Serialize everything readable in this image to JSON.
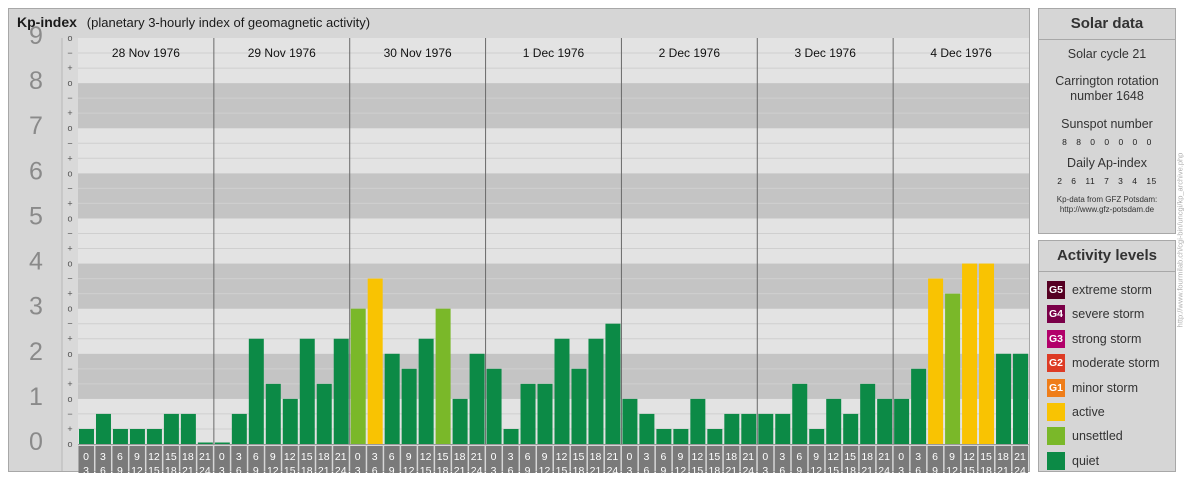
{
  "header": {
    "title": "Kp-index",
    "subtitle": "(planetary 3-hourly index of geomagnetic activity)"
  },
  "chart_data": {
    "type": "bar",
    "title": "Kp-index",
    "subtitle": "(planetary 3-hourly index of geomagnetic activity)",
    "ylim": [
      0,
      9
    ],
    "y_major_ticks": [
      "0",
      "1",
      "2",
      "3",
      "4",
      "5",
      "6",
      "7",
      "8",
      "9"
    ],
    "y_minor_tick_labels": [
      "+",
      "o",
      "−"
    ],
    "x_hour_start_labels": [
      "0",
      "3",
      "6",
      "9",
      "12",
      "15",
      "18",
      "21"
    ],
    "x_hour_end_labels": [
      "3",
      "6",
      "9",
      "12",
      "15",
      "18",
      "21",
      "24"
    ],
    "days": [
      {
        "date": "28 Nov 1976",
        "kp": [
          0.333,
          0.667,
          0.333,
          0.333,
          0.333,
          0.667,
          0.667,
          0.0
        ]
      },
      {
        "date": "29 Nov 1976",
        "kp": [
          0.0,
          0.667,
          2.333,
          1.333,
          1.0,
          2.333,
          1.333,
          2.333
        ]
      },
      {
        "date": "30 Nov 1976",
        "kp": [
          3.0,
          3.667,
          2.0,
          1.667,
          2.333,
          3.0,
          1.0,
          2.0
        ]
      },
      {
        "date": "1 Dec 1976",
        "kp": [
          1.667,
          0.333,
          1.333,
          1.333,
          2.333,
          1.667,
          2.333,
          2.667
        ]
      },
      {
        "date": "2 Dec 1976",
        "kp": [
          1.0,
          0.667,
          0.333,
          0.333,
          1.0,
          0.333,
          0.667,
          0.667
        ]
      },
      {
        "date": "3 Dec 1976",
        "kp": [
          0.667,
          0.667,
          1.333,
          0.333,
          1.0,
          0.667,
          1.333,
          1.0
        ]
      },
      {
        "date": "4 Dec 1976",
        "kp": [
          1.0,
          1.667,
          3.667,
          3.333,
          4.0,
          4.0,
          2.0,
          2.0
        ]
      }
    ],
    "color_scale": [
      {
        "level": "quiet",
        "max_kp": 2.99,
        "color": "#0c8a46"
      },
      {
        "level": "unsettled",
        "max_kp": 3.49,
        "color": "#7ab829"
      },
      {
        "level": "active",
        "max_kp": 4.99,
        "color": "#f9c302"
      }
    ],
    "colors": {
      "panel_bg": "#d6d6d6",
      "band_dark": "#c4c4c4",
      "band_light": "#e3e3e3",
      "minor_line": "#cfcfcf",
      "tick_gutter": "#d9d9d9",
      "axis_number": "#8a8a8a",
      "hour_cell": "#7a7a7a",
      "day_divider": "#6a6a6a"
    }
  },
  "solar_data": {
    "title": "Solar data",
    "solar_cycle": "Solar cycle 21",
    "carrington_line1": "Carrington rotation",
    "carrington_line2": "number 1648",
    "sunspot_label": "Sunspot number",
    "sunspot_values": "8 8 0 0 0 0 0",
    "ap_label": "Daily Ap-index",
    "ap_values": "2 6 11 7 3 4 15",
    "source_line1": "Kp-data from GFZ Potsdam:",
    "source_line2": "http://www.gfz-potsdam.de"
  },
  "activity_levels": {
    "title": "Activity levels",
    "items": [
      {
        "code": "G5",
        "label": "extreme storm",
        "color": "#550022"
      },
      {
        "code": "G4",
        "label": "severe storm",
        "color": "#7a0048"
      },
      {
        "code": "G3",
        "label": "strong storm",
        "color": "#b2006a"
      },
      {
        "code": "G2",
        "label": "moderate storm",
        "color": "#dd3b25"
      },
      {
        "code": "G1",
        "label": "minor storm",
        "color": "#ef7d18"
      },
      {
        "code": "",
        "label": "active",
        "color": "#f9c302"
      },
      {
        "code": "",
        "label": "unsettled",
        "color": "#7ab829"
      },
      {
        "code": "",
        "label": "quiet",
        "color": "#0c8a46"
      }
    ]
  },
  "credit": "http://www.fourmilab.ch/cgi-bin/uncgi/kp_archive.php"
}
